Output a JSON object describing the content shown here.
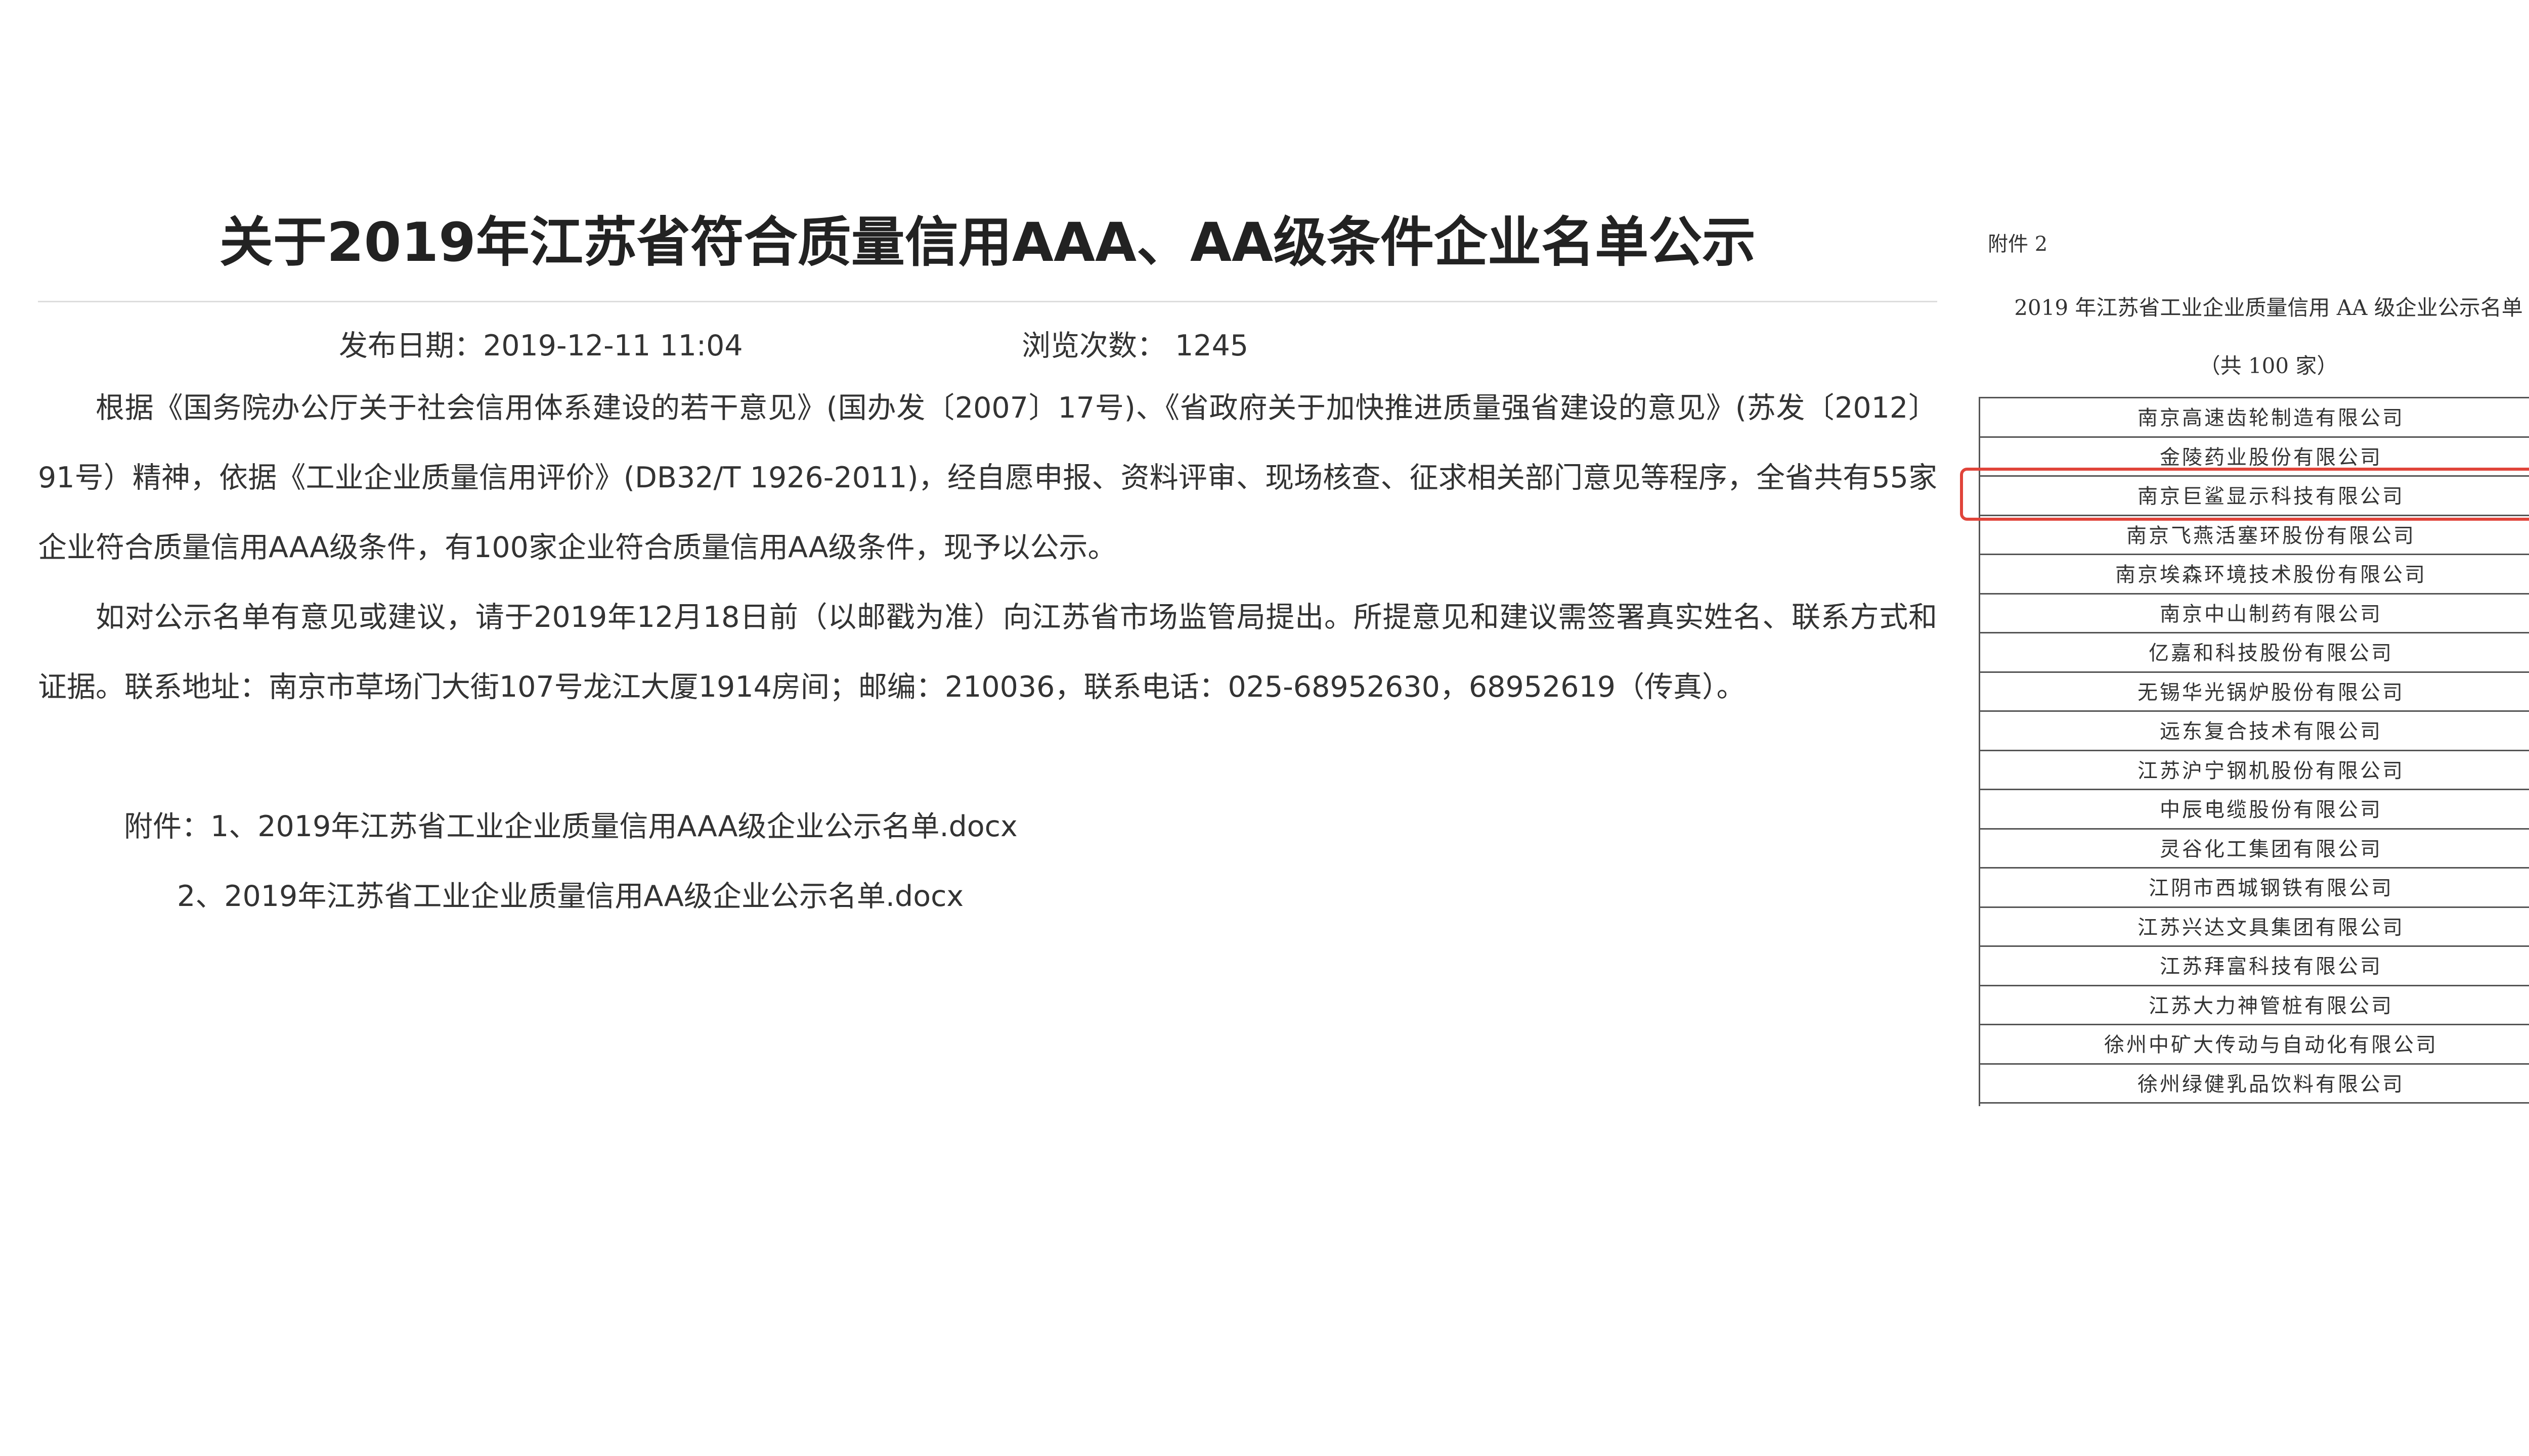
{
  "article": {
    "title": "关于2019年江苏省符合质量信用AAA、AA级条件企业名单公示",
    "publish_date": "发布日期：2019-12-11 11:04",
    "view_count": "浏览次数：  1245",
    "paragraphs": [
      "根据《国务院办公厅关于社会信用体系建设的若干意见》(国办发〔2007〕17号)、《省政府关于加快推进质量强省建设的意见》(苏发〔2012〕91号）精神，依据《工业企业质量信用评价》(DB32/T 1926-2011)，经自愿申报、资料评审、现场核查、征求相关部门意见等程序，全省共有55家企业符合质量信用AAA级条件，有100家企业符合质量信用AA级条件，现予以公示。",
      "如对公示名单有意见或建议，请于2019年12月18日前（以邮戳为准）向江苏省市场监管局提出。所提意见和建议需签署真实姓名、联系方式和证据。联系地址：南京市草场门大街107号龙江大厦1914房间；邮编：210036，联系电话：025-68952630，68952619（传真）。"
    ],
    "attachments": [
      "附件：1、2019年江苏省工业企业质量信用AAA级企业公示名单.docx",
      "2、2019年江苏省工业企业质量信用AA级企业公示名单.docx"
    ]
  },
  "annex": {
    "label": "附件 2",
    "heading": "2019 年江苏省工业企业质量信用 AA 级企业公示名单",
    "count": "（共 100 家）",
    "companies": [
      "南京高速齿轮制造有限公司",
      "金陵药业股份有限公司",
      "南京巨鲨显示科技有限公司",
      "南京飞燕活塞环股份有限公司",
      "南京埃森环境技术股份有限公司",
      "南京中山制药有限公司",
      "亿嘉和科技股份有限公司",
      "无锡华光锅炉股份有限公司",
      "远东复合技术有限公司",
      "江苏沪宁钢机股份有限公司",
      "中辰电缆股份有限公司",
      "灵谷化工集团有限公司",
      "江阴市西城钢铁有限公司",
      "江苏兴达文具集团有限公司",
      "江苏拜富科技有限公司",
      "江苏大力神管桩有限公司",
      "徐州中矿大传动与自动化有限公司",
      "徐州绿健乳品饮料有限公司"
    ],
    "highlighted_index": 2
  },
  "colors": {
    "highlight": "#e0443a",
    "rule": "#dddddd",
    "text": "#333333"
  }
}
